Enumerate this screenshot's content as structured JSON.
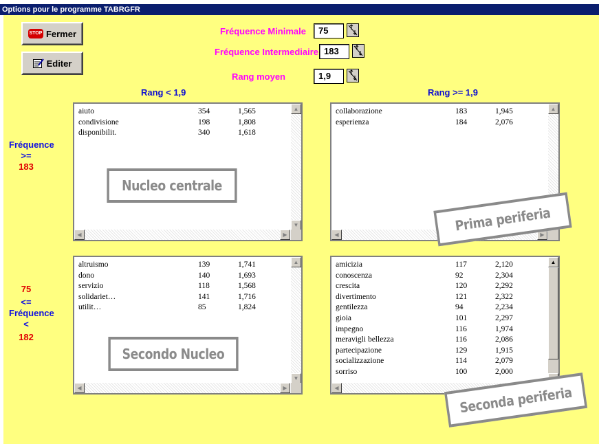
{
  "window": {
    "title": "Options pour le programme TABRGFR"
  },
  "buttons": {
    "fermer": "Fermer",
    "editer": "Editer",
    "stop_icon_text": "STOP"
  },
  "params": {
    "freq_min": {
      "label": "Fréquence Minimale",
      "value": "75"
    },
    "freq_inter": {
      "label": "Fréquence Intermediaire",
      "value": "183"
    },
    "rang_moyen": {
      "label": "Rang moyen",
      "value": "1,9"
    }
  },
  "columns": {
    "left": "Rang < 1,9",
    "right": "Rang >= 1,9"
  },
  "row_labels": {
    "top": {
      "line1": "Fréquence",
      "line2": ">=",
      "line3": "183"
    },
    "bottom": {
      "line1": "75",
      "line2": "<=",
      "line3": "Fréquence",
      "line4": "<",
      "line5": "182"
    }
  },
  "quadrants": {
    "top_left": {
      "stamp": "Nucleo centrale",
      "rows": [
        [
          "aiuto",
          "354",
          "1,565"
        ],
        [
          "condivisione",
          "198",
          "1,808"
        ],
        [
          "disponibilit.",
          "340",
          "1,618"
        ]
      ]
    },
    "top_right": {
      "stamp": "Prima periferia",
      "rows": [
        [
          "collaborazione",
          "183",
          "1,945"
        ],
        [
          "esperienza",
          "184",
          "2,076"
        ]
      ]
    },
    "bottom_left": {
      "stamp": "Secondo Nucleo",
      "rows": [
        [
          "altruismo",
          "139",
          "1,741"
        ],
        [
          "dono",
          "140",
          "1,693"
        ],
        [
          "servizio",
          "118",
          "1,568"
        ],
        [
          "solidariet…",
          "141",
          "1,716"
        ],
        [
          "utilit…",
          "85",
          "1,824"
        ]
      ]
    },
    "bottom_right": {
      "stamp": "Seconda periferia",
      "rows": [
        [
          "amicizia",
          "117",
          "2,120"
        ],
        [
          "conoscenza",
          "92",
          "2,304"
        ],
        [
          "crescita",
          "120",
          "2,292"
        ],
        [
          "divertimento",
          "121",
          "2,322"
        ],
        [
          "gentilezza",
          "94",
          "2,234"
        ],
        [
          "gioia",
          "101",
          "2,297"
        ],
        [
          "impegno",
          "116",
          "1,974"
        ],
        [
          "meravigli bellezza",
          "116",
          "2,086"
        ],
        [
          "partecipazione",
          "129",
          "1,915"
        ],
        [
          "socializzazione",
          "114",
          "2,079"
        ],
        [
          "sorriso",
          "100",
          "2,000"
        ]
      ]
    }
  }
}
